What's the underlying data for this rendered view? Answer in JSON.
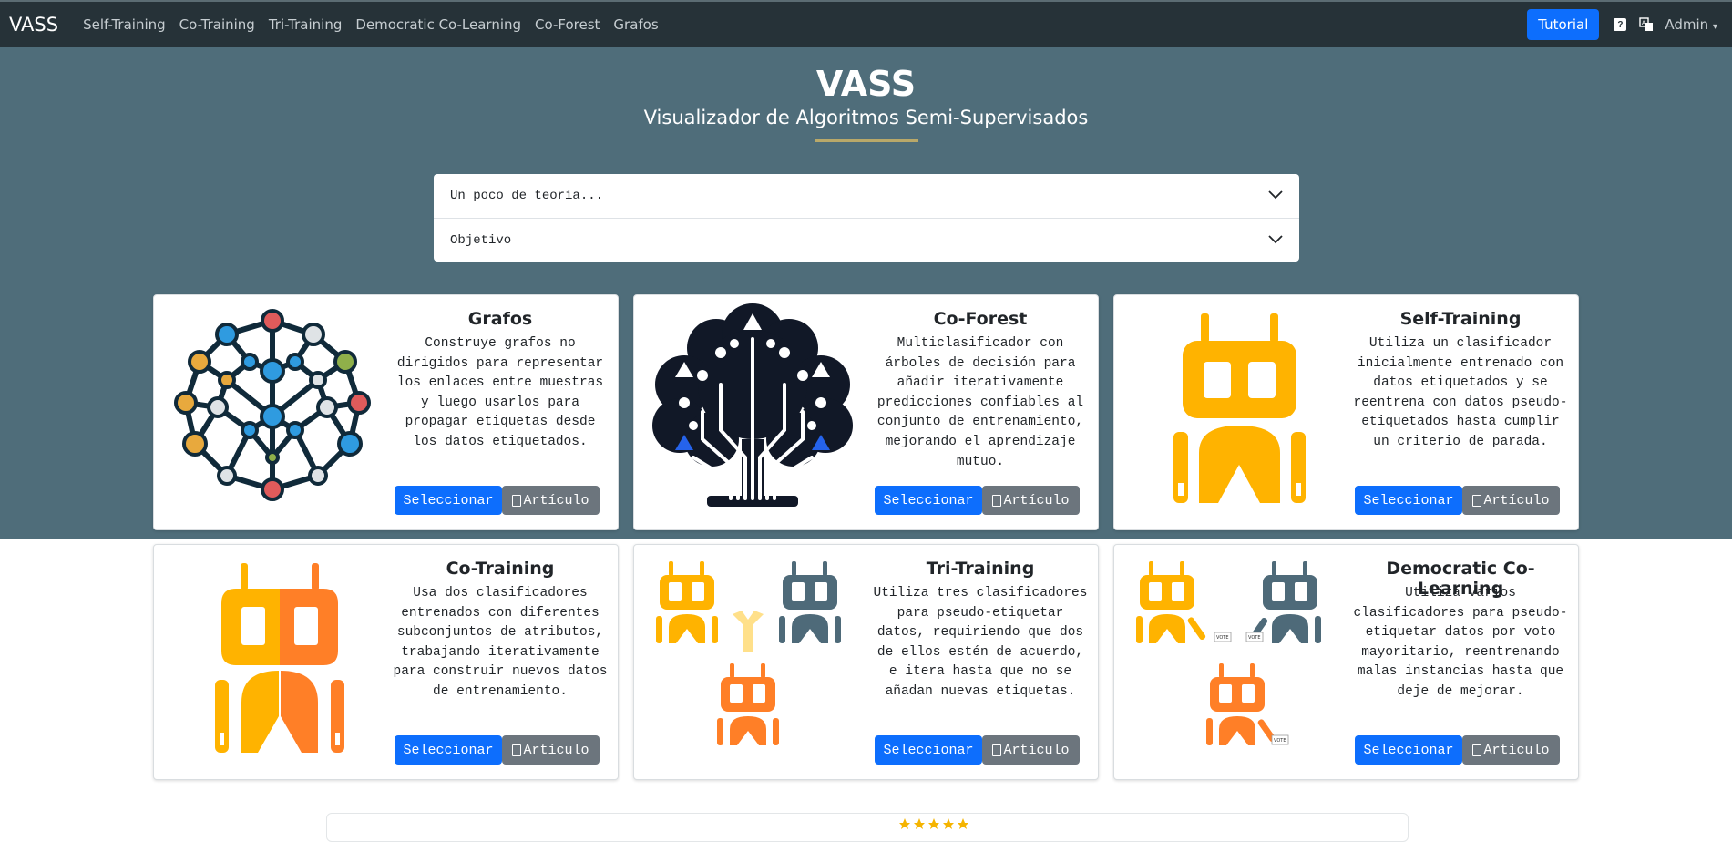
{
  "navbar": {
    "brand": "VASS",
    "links": [
      "Self-Training",
      "Co-Training",
      "Tri-Training",
      "Democratic Co-Learning",
      "Co-Forest",
      "Grafos"
    ],
    "tutorial_label": "Tutorial",
    "help_icon_text": "?",
    "admin_label": "Admin"
  },
  "hero": {
    "title": "VASS",
    "subtitle": "Visualizador de Algoritmos Semi-Supervisados"
  },
  "accordion": [
    {
      "label": "Un poco de teoría..."
    },
    {
      "label": "Objetivo"
    }
  ],
  "cards": [
    {
      "title": "Grafos",
      "text": "Construye grafos no dirigidos para representar los enlaces entre muestras y luego usarlos para propagar etiquetas desde los datos etiquetados.",
      "select_label": "Seleccionar",
      "article_label": "Artículo",
      "icon": "graph-network-icon"
    },
    {
      "title": "Co-Forest",
      "text": "Multiclasificador con árboles de decisión para añadir iterativamente predicciones confiables al conjunto de entrenamiento, mejorando el aprendizaje mutuo.",
      "select_label": "Seleccionar",
      "article_label": "Artículo",
      "icon": "circuit-tree-icon"
    },
    {
      "title": "Self-Training",
      "text": "Utiliza un clasificador inicialmente entrenado con datos etiquetados y se reentrena con datos pseudo-etiquetados hasta cumplir un criterio de parada.",
      "select_label": "Seleccionar",
      "article_label": "Artículo",
      "icon": "robot-icon"
    },
    {
      "title": "Co-Training",
      "text": "Usa dos clasificadores entrenados con diferentes subconjuntos de atributos, trabajando iterativamente para construir nuevos datos de entrenamiento.",
      "select_label": "Seleccionar",
      "article_label": "Artículo",
      "icon": "two-robots-icon"
    },
    {
      "title": "Tri-Training",
      "text": "Utiliza tres clasificadores para pseudo-etiquetar datos, requiriendo que dos de ellos estén de acuerdo, e itera hasta que no se añadan nuevas etiquetas.",
      "select_label": "Seleccionar",
      "article_label": "Artículo",
      "icon": "three-robots-icon"
    },
    {
      "title": "Democratic Co-Learning",
      "text": "Utiliza varios clasificadores para pseudo-etiquetar datos por voto mayoritario, reentrenando malas instancias hasta que deje de mejorar.",
      "select_label": "Seleccionar",
      "article_label": "Artículo",
      "icon": "voting-robots-icon"
    }
  ],
  "vote_labels": [
    "VOTE",
    "VOTE",
    "VOTE"
  ],
  "colors": {
    "navbar": "#263238",
    "hero": "#4f6d7a",
    "primary": "#0d6efd",
    "secondary": "#6c757d",
    "accent_underline": "#b9a869",
    "robot_yellow": "#ffb300",
    "robot_orange": "#ff7f27",
    "robot_slate": "#4e6a79"
  }
}
